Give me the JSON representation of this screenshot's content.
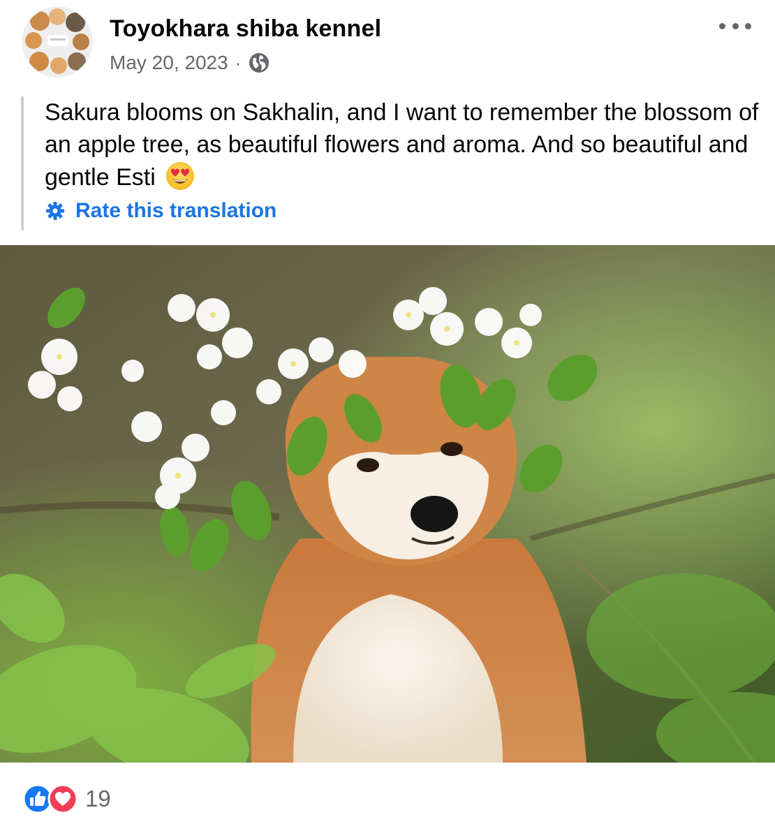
{
  "post": {
    "author": "Toyokhara shiba kennel",
    "date": "May 20, 2023",
    "separator": "·",
    "privacy_icon": "globe-icon",
    "more_icon": "more-options-icon",
    "text": "Sakura blooms on Sakhalin, and I want to remember the blossom of an apple tree, as beautiful flowers and aroma. And so beautiful and gentle Esti",
    "text_emoji": "heart-eyes-emoji",
    "rate_translation_label": "Rate this translation",
    "rate_translation_icon": "gear-icon"
  },
  "reactions": {
    "icons": [
      "like-icon",
      "love-icon"
    ],
    "count": "19"
  },
  "colors": {
    "link_blue": "#1b74e4",
    "meta_gray": "#65676b",
    "like_blue": "#1877f2",
    "love_red": "#f33e58",
    "quote_bar": "#ced0d4"
  }
}
